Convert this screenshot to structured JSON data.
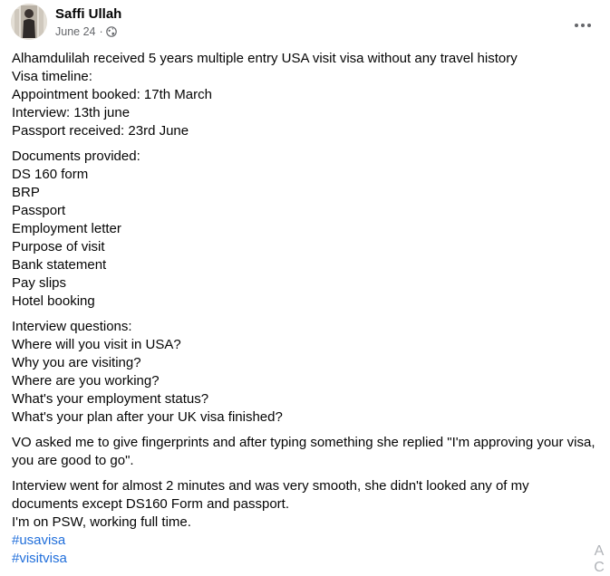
{
  "post": {
    "author": "Saffi Ullah",
    "date": "June 24",
    "separator": "·",
    "privacy_icon": "globe-icon",
    "more_icon": "more-horizontal-icon",
    "paragraphs": [
      [
        "Alhamdulilah received 5 years multiple entry USA visit visa without any travel history",
        "Visa timeline:",
        "Appointment booked: 17th March",
        "Interview: 13th june",
        "Passport received: 23rd June"
      ],
      [
        "Documents provided:",
        "DS 160 form",
        "BRP",
        "Passport",
        "Employment letter",
        "Purpose of visit",
        "Bank statement",
        "Pay slips",
        "Hotel booking"
      ],
      [
        "Interview questions:",
        "Where will you visit in USA?",
        "Why you are visiting?",
        "Where are you working?",
        "What's your employment status?",
        "What's your plan after your UK visa finished?"
      ],
      [
        "VO asked me to give fingerprints and after typing something she replied \"I'm approving your visa,",
        "you are good to go\"."
      ],
      [
        "Interview went for almost 2 minutes and was very smooth, she didn't looked any of my",
        "documents except DS160 Form and passport.",
        "I'm on PSW, working full time."
      ]
    ],
    "hashtags": [
      "#usavisa",
      "#visitvisa"
    ]
  },
  "edge_glyphs": [
    "A",
    "C"
  ],
  "colors": {
    "text": "#050505",
    "secondary": "#65676b",
    "link": "#216fdb"
  }
}
